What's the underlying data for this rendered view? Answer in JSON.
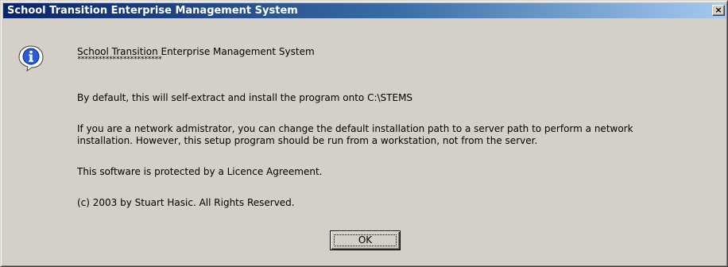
{
  "window": {
    "title": "School Transition Enterprise Management System",
    "close_label": "×"
  },
  "message": {
    "heading": "School Transition Enterprise Management System",
    "stars": "************************",
    "line_default": "By default, this will self-extract and install the program onto C:\\STEMS",
    "line_network_1": "If you are a network admistrator, you can change the default installation path to a server path to perform a network",
    "line_network_2": "installation.  However, this setup program should be run from a workstation, not from the server.",
    "line_licence": "This software is protected by a Licence Agreement.",
    "line_copyright": "(c) 2003 by Stuart Hasic. All Rights Reserved."
  },
  "buttons": {
    "ok_label": "OK"
  },
  "icon": {
    "name": "information-icon",
    "color": "#2a5bd7"
  }
}
